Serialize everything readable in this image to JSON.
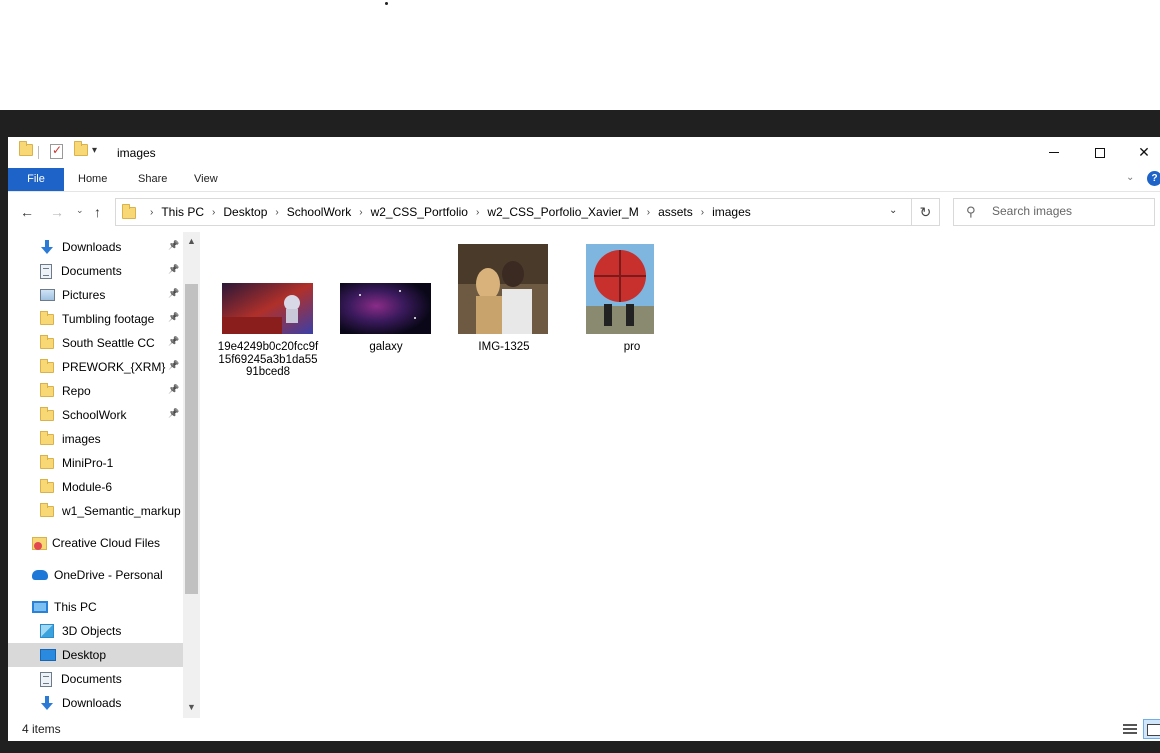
{
  "window": {
    "title": "images",
    "controls": {
      "minimize": "minimize",
      "maximize": "maximize",
      "close": "✕"
    }
  },
  "ribbon": {
    "tabs": [
      {
        "label": "File"
      },
      {
        "label": "Home"
      },
      {
        "label": "Share"
      },
      {
        "label": "View"
      }
    ]
  },
  "address": {
    "breadcrumbs": [
      "This PC",
      "Desktop",
      "SchoolWork",
      "w2_CSS_Portfolio",
      "w2_CSS_Porfolio_Xavier_M",
      "assets",
      "images"
    ]
  },
  "search": {
    "placeholder": "Search images"
  },
  "nav_pane": {
    "items": [
      {
        "label": "Downloads",
        "icon": "download-arrow-icon",
        "pinned": true,
        "selected": false
      },
      {
        "label": "Documents",
        "icon": "documents-icon",
        "pinned": true,
        "selected": false
      },
      {
        "label": "Pictures",
        "icon": "pictures-icon",
        "pinned": true,
        "selected": false
      },
      {
        "label": "Tumbling footage",
        "icon": "folder-icon",
        "pinned": true,
        "selected": false
      },
      {
        "label": "South Seattle CC",
        "icon": "folder-icon",
        "pinned": true,
        "selected": false
      },
      {
        "label": "PREWORK_{XRM}",
        "icon": "folder-icon",
        "pinned": true,
        "selected": false
      },
      {
        "label": "Repo",
        "icon": "folder-icon",
        "pinned": true,
        "selected": false
      },
      {
        "label": "SchoolWork",
        "icon": "folder-icon",
        "pinned": true,
        "selected": false
      },
      {
        "label": "images",
        "icon": "folder-icon",
        "pinned": false,
        "selected": false
      },
      {
        "label": "MiniPro-1",
        "icon": "folder-icon",
        "pinned": false,
        "selected": false
      },
      {
        "label": "Module-6",
        "icon": "folder-icon",
        "pinned": false,
        "selected": false
      },
      {
        "label": "w1_Semantic_markup",
        "icon": "folder-icon",
        "pinned": false,
        "selected": false
      },
      {
        "label": "Creative Cloud Files",
        "icon": "creative-cloud-icon",
        "pinned": false,
        "selected": false
      },
      {
        "label": "OneDrive - Personal",
        "icon": "onedrive-cloud-icon",
        "pinned": false,
        "selected": false
      },
      {
        "label": "This PC",
        "icon": "this-pc-icon",
        "pinned": false,
        "selected": false
      },
      {
        "label": "3D Objects",
        "icon": "3d-objects-icon",
        "pinned": false,
        "selected": false
      },
      {
        "label": "Desktop",
        "icon": "desktop-icon",
        "pinned": false,
        "selected": true
      },
      {
        "label": "Documents",
        "icon": "documents-icon",
        "pinned": false,
        "selected": false
      },
      {
        "label": "Downloads",
        "icon": "download-arrow-icon",
        "pinned": false,
        "selected": false
      }
    ]
  },
  "files": [
    {
      "name": "19e4249b0c20fcc9f15f69245a3b1da5591bced8",
      "thumb": "astronaut-red-landscape"
    },
    {
      "name": "galaxy",
      "thumb": "galaxy-purple"
    },
    {
      "name": "IMG-1325",
      "thumb": "couple-photo"
    },
    {
      "name": "pro",
      "thumb": "world-of-sports-globe"
    }
  ],
  "status": {
    "item_count": "4 items"
  },
  "colors": {
    "accent": "#1e64c8",
    "selected_nav": "#d9d9d9",
    "background_dark": "#202020"
  }
}
